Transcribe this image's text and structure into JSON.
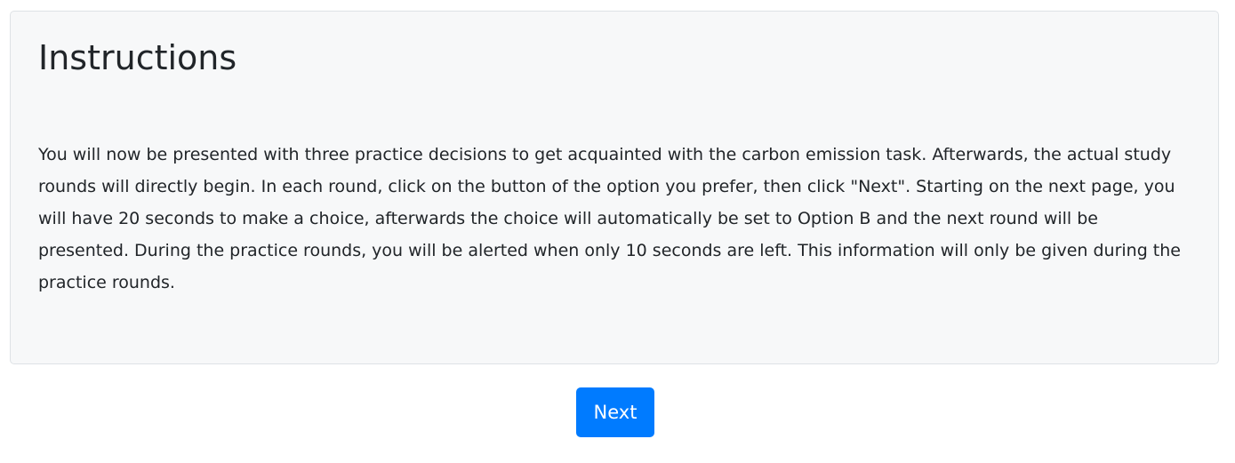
{
  "card": {
    "title": "Instructions",
    "body": "You will now be presented with three practice decisions to get acquainted with the carbon emission task. Afterwards, the actual study rounds will directly begin. In each round, click on the button of the option you prefer, then click \"Next\". Starting on the next page, you will have 20 seconds to make a choice, afterwards the choice will automatically be set to Option B and the next round will be presented. During the practice rounds, you will be alerted when only 10 seconds are left. This information will only be given during the practice rounds."
  },
  "actions": {
    "next_label": "Next"
  },
  "colors": {
    "card_background": "#f7f8f9",
    "card_border": "#dee2e6",
    "primary_button": "#007bff",
    "text": "#212529"
  }
}
